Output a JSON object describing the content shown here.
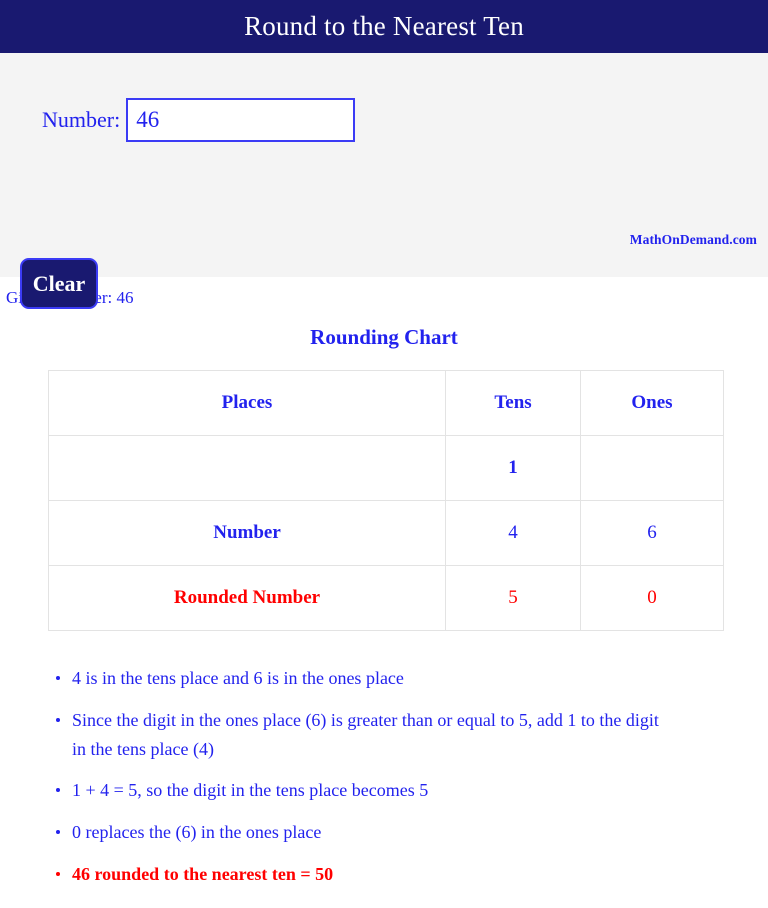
{
  "header": {
    "title": "Round to the Nearest Ten"
  },
  "form": {
    "number_label": "Number:",
    "number_value": "46",
    "number_placeholder": "",
    "clear_label": "Clear",
    "watermark": "MathOnDemand.com"
  },
  "given": {
    "text": "Given Number: 46"
  },
  "chart": {
    "title": "Rounding Chart",
    "columns": [
      "Places",
      "Tens",
      "Ones"
    ],
    "rows": [
      {
        "label": "",
        "tens": "1",
        "ones": ""
      },
      {
        "label": "Number",
        "tens": "4",
        "ones": "6"
      },
      {
        "label": "Rounded Number",
        "tens": "5",
        "ones": "0"
      }
    ]
  },
  "steps": [
    "4 is in the tens place and 6 is in the ones place",
    "Since the digit in the ones place (6) is greater than or equal to 5, add 1 to the digit in the tens place (4)",
    "1 + 4 = 5, so the digit in the tens place becomes 5",
    "0 replaces the (6) in the ones place",
    "46 rounded to the nearest ten = 50"
  ],
  "colors": {
    "navy": "#191970",
    "blue": "#2222ee",
    "red": "#ff0000",
    "panel": "#f4f4f4"
  }
}
